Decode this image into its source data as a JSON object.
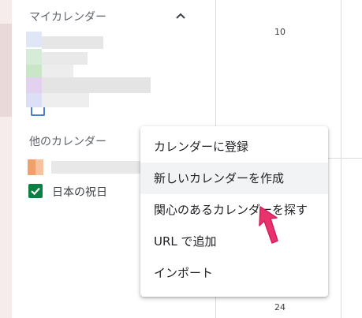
{
  "sidebar": {
    "my_calendars_title": "マイカレンダー",
    "other_calendars_title": "他のカレンダー",
    "holiday_calendar_label": "日本の祝日"
  },
  "grid": {
    "date_top": "10",
    "date_bottom": "24"
  },
  "menu": {
    "items": [
      "カレンダーに登録",
      "新しいカレンダーを作成",
      "関心のあるカレンダーを探す",
      "URL で追加",
      "インポート"
    ]
  },
  "colors": {
    "holiday_checkbox": "#0b8043",
    "cursor": "#e8336d"
  },
  "icons": {
    "collapse": "chevron-up-icon",
    "checkbox": "check-icon",
    "cursor": "arrow-cursor-icon"
  }
}
